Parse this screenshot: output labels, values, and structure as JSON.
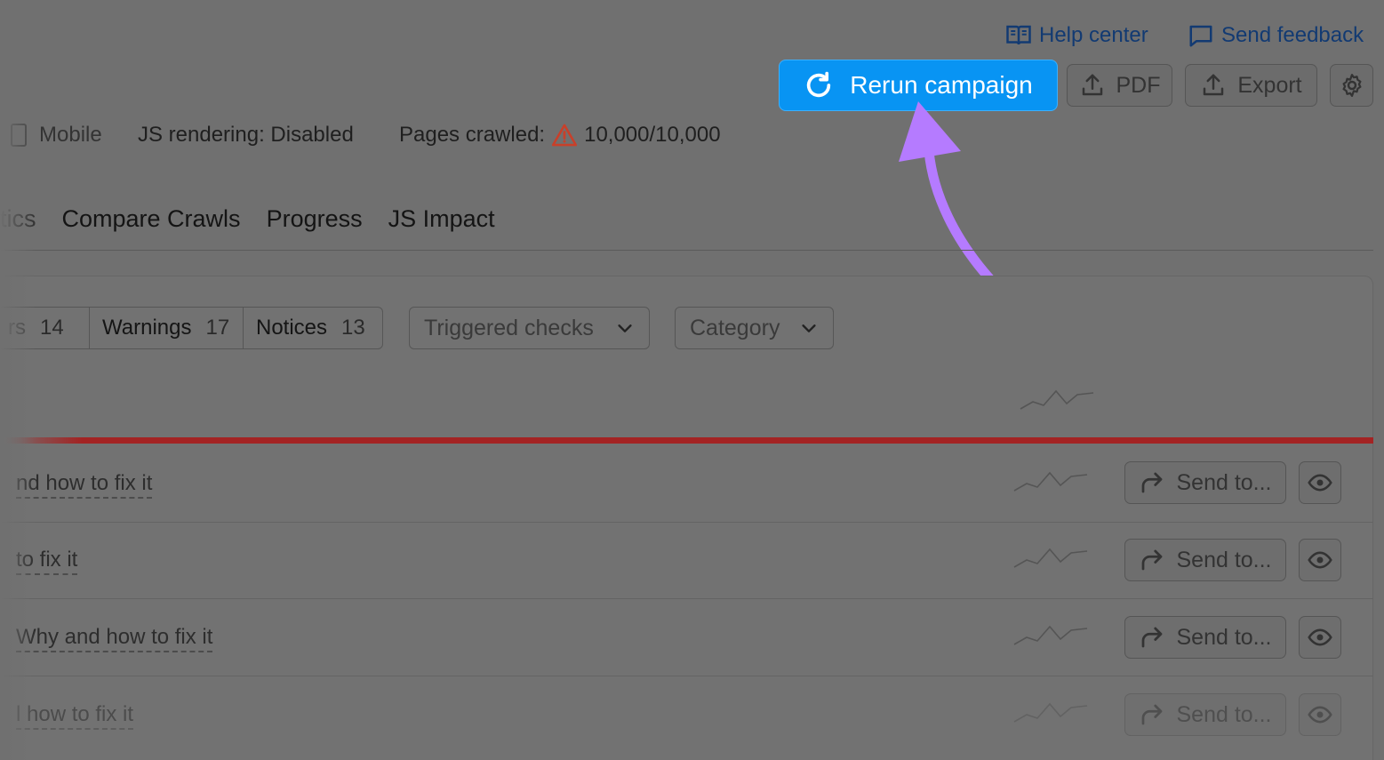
{
  "header": {
    "help_center": "Help center",
    "send_feedback": "Send feedback",
    "rerun_label": "Rerun campaign",
    "pdf_label": "PDF",
    "export_label": "Export"
  },
  "info": {
    "device": "Mobile",
    "js_rendering": "JS rendering: Disabled",
    "pages_crawled_label": "Pages crawled:",
    "pages_crawled_value": "10,000/10,000"
  },
  "tabs": [
    "tics",
    "Compare Crawls",
    "Progress",
    "JS Impact"
  ],
  "filters": {
    "segments": [
      {
        "label": "rs",
        "count": "14"
      },
      {
        "label": "Warnings",
        "count": "17"
      },
      {
        "label": "Notices",
        "count": "13"
      }
    ],
    "triggered_checks": "Triggered checks",
    "category": "Category"
  },
  "rows": [
    {
      "issue": "nd how to fix it",
      "action": "Send to..."
    },
    {
      "issue": " to fix it",
      "action": "Send to..."
    },
    {
      "issue": "Why and how to fix it",
      "action": "Send to..."
    },
    {
      "issue": "l how to fix it",
      "action": "Send to..."
    }
  ],
  "colors": {
    "accent": "#0894f3",
    "error_bar": "#a32323",
    "annotation_arrow": "#b57bff",
    "warning_icon": "#c8402a",
    "link": "#123a72"
  }
}
